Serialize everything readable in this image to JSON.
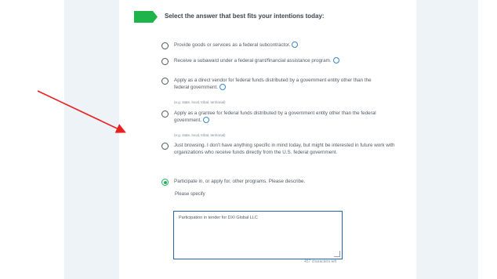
{
  "heading": "Select the answer that best fits your intentions today:",
  "options": [
    {
      "label": "Provide goods or services as a federal subcontractor.",
      "info_icon": true,
      "selected": false
    },
    {
      "label": "Receive a subaward under a federal grant/financial assistance program.",
      "info_icon": true,
      "selected": false
    },
    {
      "label": "Apply as a direct vendor for federal funds distributed by a government entity other than the federal government.",
      "info_icon": true,
      "hint": "(e.g. state, local, tribal, territorial)",
      "selected": false
    },
    {
      "label": "Apply as a grantee for federal funds distributed by a government entity other than the federal government.",
      "info_icon": true,
      "hint": "(e.g. state, local, tribal, territorial)",
      "selected": false
    },
    {
      "label": "Just browsing. I don't have anything specific in mind today, but might be interested in future work with organizations who receive funds directly from the U.S. federal government.",
      "info_icon": false,
      "selected": false
    },
    {
      "label": "Participate in, or apply for, other programs. Please describe.",
      "info_icon": false,
      "selected": true
    }
  ],
  "specify_label": "Please specify",
  "textarea_value": "Participation in tender for DXI Global LLC",
  "char_count": "457 characters left",
  "colors": {
    "accent_green": "#1fb44a",
    "info_blue": "#3a86c8",
    "focus_blue": "#1f66b0",
    "annotation_arrow": "#e8201f"
  },
  "icons": {
    "flag": "green-flag-icon",
    "info": "info-circle-icon",
    "arrow": "red-arrow-annotation"
  }
}
